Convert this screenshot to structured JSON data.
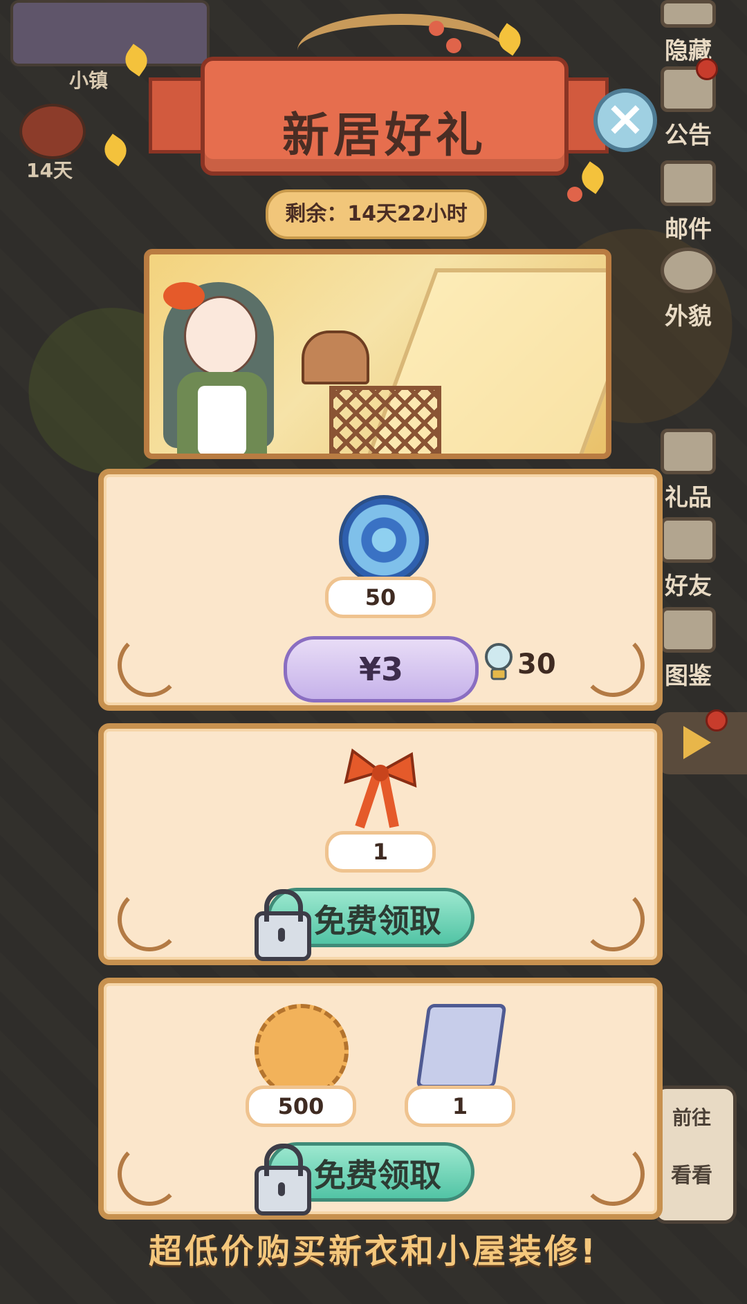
{
  "hud": {
    "town_label": "小镇",
    "event_timer": "14天",
    "side_menu": [
      "隐藏",
      "公告",
      "邮件",
      "外貌",
      "礼品",
      "好友",
      "图鉴"
    ],
    "goto_card": {
      "go": "前往",
      "look": "看看"
    }
  },
  "dialog": {
    "title": "新居好礼",
    "remaining": "剩余：14天22小时",
    "close_icon": "close-x",
    "packs": [
      {
        "items": [
          {
            "icon": "blue-swirl-gem-icon",
            "qty": "50"
          }
        ],
        "price": "¥3",
        "alt_price_icon": "lightbulb-icon",
        "alt_price": "30"
      },
      {
        "items": [
          {
            "icon": "red-ribbon-bow-icon",
            "qty": "1"
          }
        ],
        "button": "免费领取",
        "locked": true
      },
      {
        "items": [
          {
            "icon": "leaf-coin-icon",
            "qty": "500"
          },
          {
            "icon": "blueprint-scroll-icon",
            "qty": "1"
          }
        ],
        "button": "免费领取",
        "locked": true
      }
    ],
    "footer": "超低价购买新衣和小屋装修!"
  },
  "colors": {
    "accent_ribbon": "#e66e4e",
    "card_bg": "#fbe6cb",
    "free_button": "#52c4a5",
    "price_button": "#c6b2ea"
  }
}
